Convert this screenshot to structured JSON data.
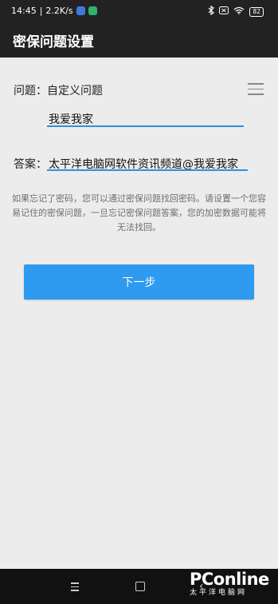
{
  "status_bar": {
    "time": "14:45",
    "speed": "2.2K/s",
    "battery": "82",
    "icons": [
      "bluetooth-icon",
      "sim-off-icon",
      "wifi-icon",
      "battery-icon"
    ]
  },
  "app_bar": {
    "title": "密保问题设置"
  },
  "question": {
    "label": "问题：",
    "type": "自定义问题",
    "value": "我爱我家"
  },
  "answer": {
    "label": "答案：",
    "value": "太平洋电脑网软件资讯频道@我爱我家"
  },
  "hint": "如果忘记了密码，您可以通过密保问题找回密码。请设置一个您容易记住的密保问题，一旦忘记密保问题答案，您的加密数据可能将无法找回。",
  "next_button": {
    "label": "下一步"
  },
  "watermark": {
    "logo": "PConline",
    "sub": "太平洋电脑网"
  },
  "colors": {
    "accent": "#2e9af0",
    "bar": "#222222",
    "background": "#ececec"
  }
}
